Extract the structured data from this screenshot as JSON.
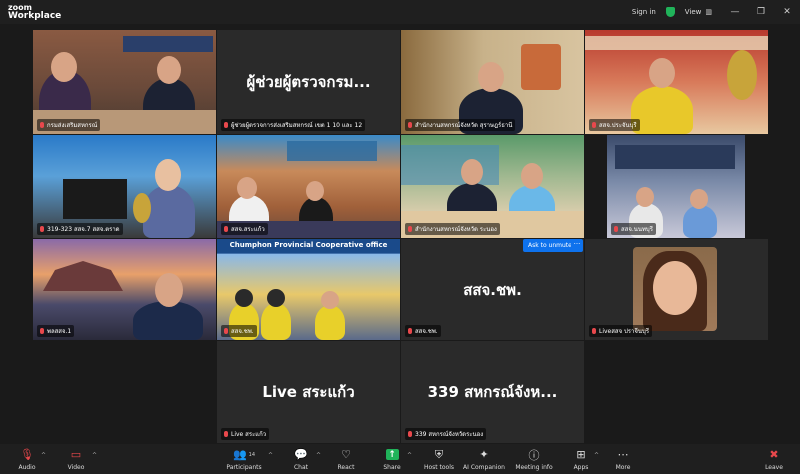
{
  "app": {
    "logo_line1": "zoom",
    "logo_line2": "Workplace"
  },
  "titlebar": {
    "sign_in": "Sign in",
    "view": "View"
  },
  "tiles": [
    {
      "id": "t1",
      "name": "กรมส่งเสริมสหกรณ์"
    },
    {
      "id": "t2",
      "name": "ผู้ช่วยผู้ตรวจการส่งเสริมสหกรณ์ เขต 1 10 และ 12",
      "big": "ผู้ช่วยผู้ตรวจกรม..."
    },
    {
      "id": "t3",
      "name": "สำนักงานสหกรณ์จังหวัด สุราษฎร์ธานี"
    },
    {
      "id": "t4",
      "name": "สสจ.ประจันบุรี"
    },
    {
      "id": "t5",
      "name": "319-323 สสจ.7 สสจ.ตราด"
    },
    {
      "id": "t6",
      "name": "สสจ.สระแก้ว"
    },
    {
      "id": "t7",
      "name": "สำนักงานสหกรณ์จังหวัด ระนอง"
    },
    {
      "id": "t8",
      "name": "สสจ.นนทบุรี"
    },
    {
      "id": "t9",
      "name": "พลสสจ.1"
    },
    {
      "id": "t10",
      "name": "สสจ.ชพ.",
      "banner": "Chumphon Provincial Cooperative office"
    },
    {
      "id": "t11",
      "name": "สสจ.ชพ.",
      "big": "สสจ.ชพ."
    },
    {
      "id": "t12",
      "name": "Liveสสจ ปราจีนบุรี"
    },
    {
      "id": "t13",
      "name": "Live สระแก้ว",
      "big": "Live สระแก้ว"
    },
    {
      "id": "t14",
      "name": "339 สหกรณ์จังหวัดระนอง",
      "big": "339 สหกรณ์จังห..."
    }
  ],
  "ask_to_unmute": "Ask to unmute",
  "more_dots": "···",
  "toolbar": {
    "audio": "Audio",
    "video": "Video",
    "participants": "Participants",
    "participants_count": "14",
    "chat": "Chat",
    "react": "React",
    "share": "Share",
    "host_tools": "Host tools",
    "ai_companion": "AI Companion",
    "meeting_info": "Meeting info",
    "apps": "Apps",
    "more": "More",
    "leave": "Leave"
  }
}
